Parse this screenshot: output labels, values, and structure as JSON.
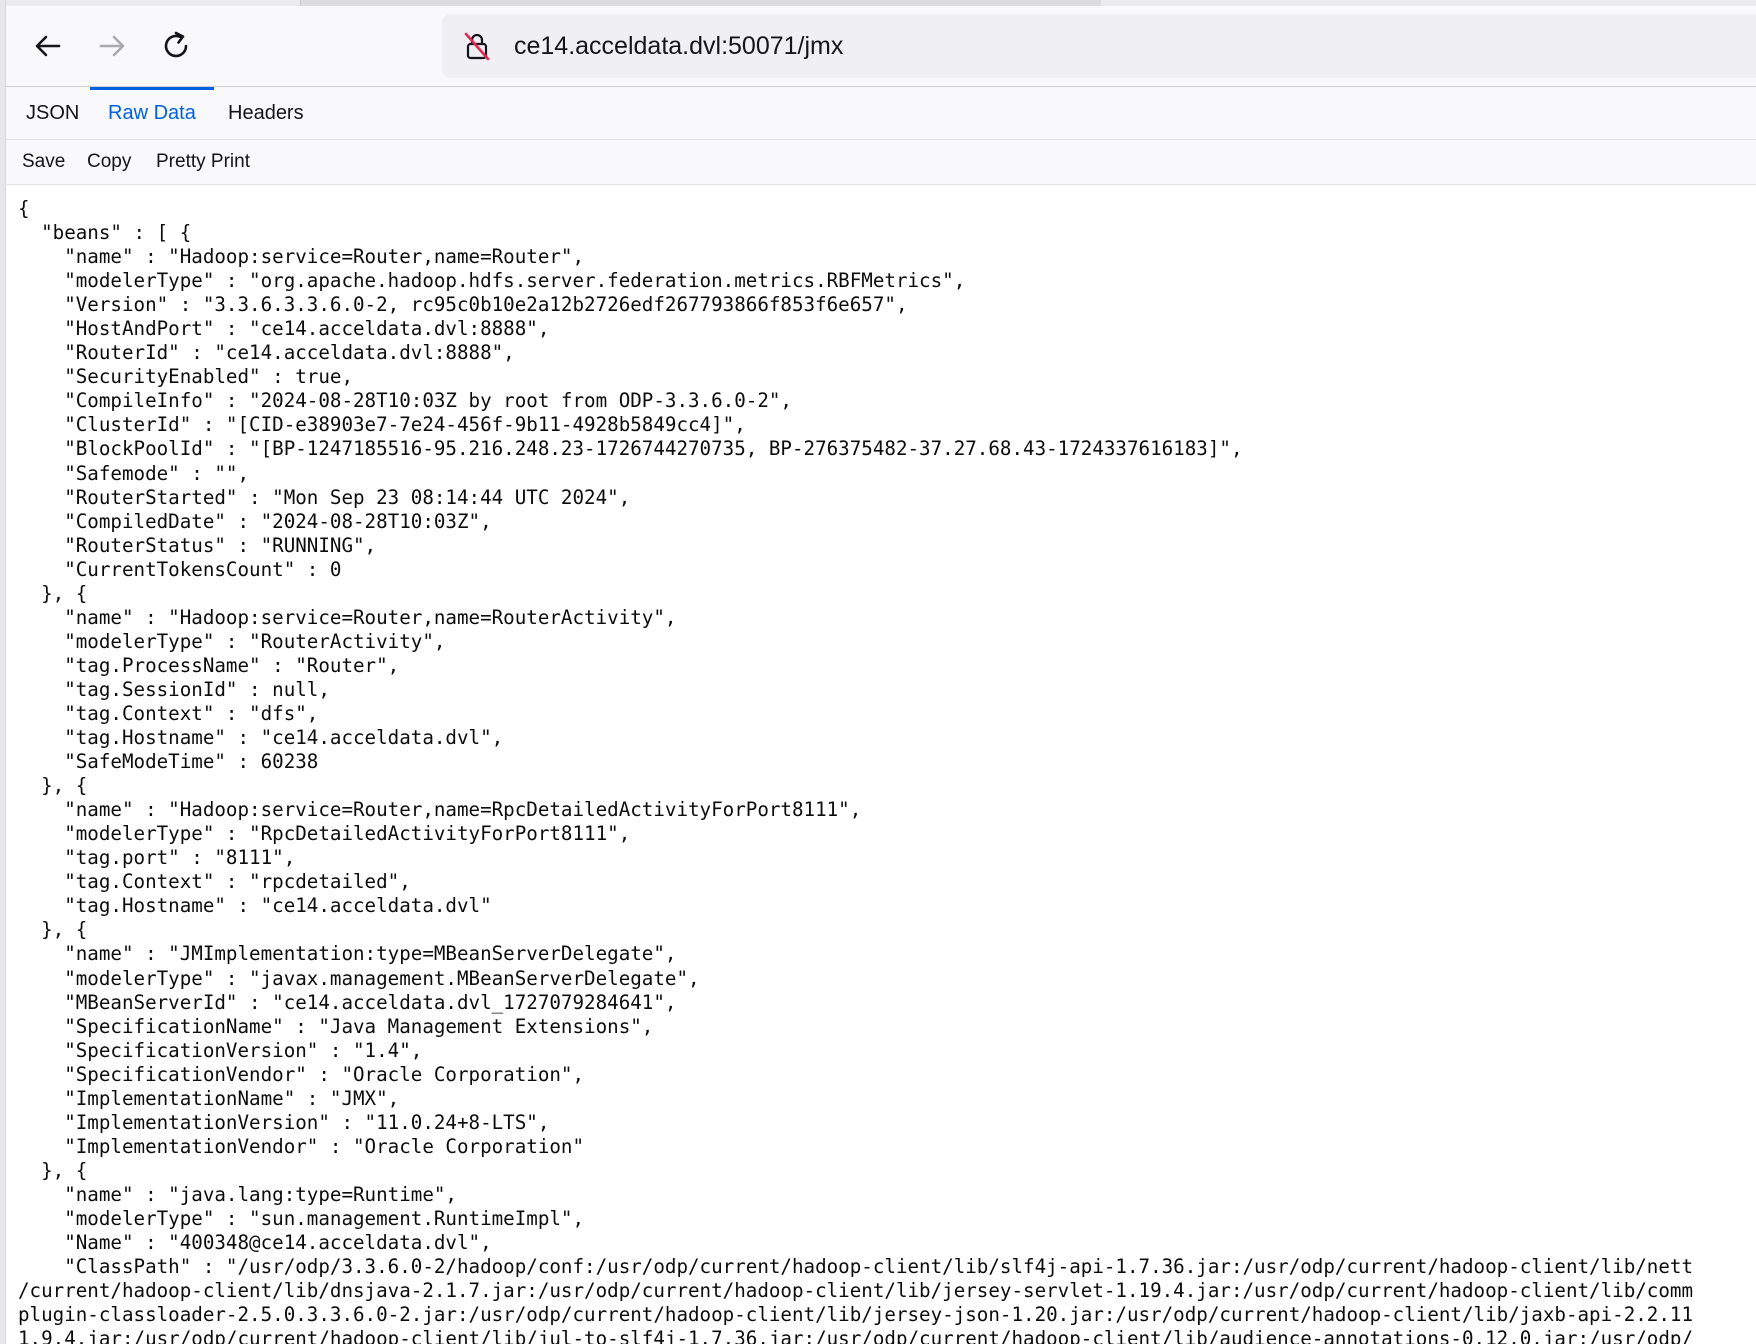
{
  "browser": {
    "url": "ce14.acceldata.dvl:50071/jmx",
    "nav": {
      "back_icon": "back-arrow-icon",
      "forward_icon": "forward-arrow-icon",
      "reload_icon": "reload-icon",
      "security_icon": "insecure-lock-icon"
    }
  },
  "viewer_tabs": [
    {
      "label": "JSON",
      "active": false
    },
    {
      "label": "Raw Data",
      "active": true
    },
    {
      "label": "Headers",
      "active": false
    }
  ],
  "actions": {
    "save": "Save",
    "copy": "Copy",
    "pretty_print": "Pretty Print"
  },
  "colors": {
    "accent": "#0061e0",
    "text": "#15141a"
  },
  "raw_lines": [
    "{",
    "  \"beans\" : [ {",
    "    \"name\" : \"Hadoop:service=Router,name=Router\",",
    "    \"modelerType\" : \"org.apache.hadoop.hdfs.server.federation.metrics.RBFMetrics\",",
    "    \"Version\" : \"3.3.6.3.3.6.0-2, rc95c0b10e2a12b2726edf267793866f853f6e657\",",
    "    \"HostAndPort\" : \"ce14.acceldata.dvl:8888\",",
    "    \"RouterId\" : \"ce14.acceldata.dvl:8888\",",
    "    \"SecurityEnabled\" : true,",
    "    \"CompileInfo\" : \"2024-08-28T10:03Z by root from ODP-3.3.6.0-2\",",
    "    \"ClusterId\" : \"[CID-e38903e7-7e24-456f-9b11-4928b5849cc4]\",",
    "    \"BlockPoolId\" : \"[BP-1247185516-95.216.248.23-1726744270735, BP-276375482-37.27.68.43-1724337616183]\",",
    "    \"Safemode\" : \"\",",
    "    \"RouterStarted\" : \"Mon Sep 23 08:14:44 UTC 2024\",",
    "    \"CompiledDate\" : \"2024-08-28T10:03Z\",",
    "    \"RouterStatus\" : \"RUNNING\",",
    "    \"CurrentTokensCount\" : 0",
    "  }, {",
    "    \"name\" : \"Hadoop:service=Router,name=RouterActivity\",",
    "    \"modelerType\" : \"RouterActivity\",",
    "    \"tag.ProcessName\" : \"Router\",",
    "    \"tag.SessionId\" : null,",
    "    \"tag.Context\" : \"dfs\",",
    "    \"tag.Hostname\" : \"ce14.acceldata.dvl\",",
    "    \"SafeModeTime\" : 60238",
    "  }, {",
    "    \"name\" : \"Hadoop:service=Router,name=RpcDetailedActivityForPort8111\",",
    "    \"modelerType\" : \"RpcDetailedActivityForPort8111\",",
    "    \"tag.port\" : \"8111\",",
    "    \"tag.Context\" : \"rpcdetailed\",",
    "    \"tag.Hostname\" : \"ce14.acceldata.dvl\"",
    "  }, {",
    "    \"name\" : \"JMImplementation:type=MBeanServerDelegate\",",
    "    \"modelerType\" : \"javax.management.MBeanServerDelegate\",",
    "    \"MBeanServerId\" : \"ce14.acceldata.dvl_1727079284641\",",
    "    \"SpecificationName\" : \"Java Management Extensions\",",
    "    \"SpecificationVersion\" : \"1.4\",",
    "    \"SpecificationVendor\" : \"Oracle Corporation\",",
    "    \"ImplementationName\" : \"JMX\",",
    "    \"ImplementationVersion\" : \"11.0.24+8-LTS\",",
    "    \"ImplementationVendor\" : \"Oracle Corporation\"",
    "  }, {",
    "    \"name\" : \"java.lang:type=Runtime\",",
    "    \"modelerType\" : \"sun.management.RuntimeImpl\",",
    "    \"Name\" : \"400348@ce14.acceldata.dvl\",",
    "    \"ClassPath\" : \"/usr/odp/3.3.6.0-2/hadoop/conf:/usr/odp/current/hadoop-client/lib/slf4j-api-1.7.36.jar:/usr/odp/current/hadoop-client/lib/nett",
    "/current/hadoop-client/lib/dnsjava-2.1.7.jar:/usr/odp/current/hadoop-client/lib/jersey-servlet-1.19.4.jar:/usr/odp/current/hadoop-client/lib/comm",
    "plugin-classloader-2.5.0.3.3.6.0-2.jar:/usr/odp/current/hadoop-client/lib/jersey-json-1.20.jar:/usr/odp/current/hadoop-client/lib/jaxb-api-2.2.11",
    "1.9.4.jar:/usr/odp/current/hadoop-client/lib/jul-to-slf4j-1.7.36.jar:/usr/odp/current/hadoop-client/lib/audience-annotations-0.12.0.jar:/usr/odp/"
  ]
}
